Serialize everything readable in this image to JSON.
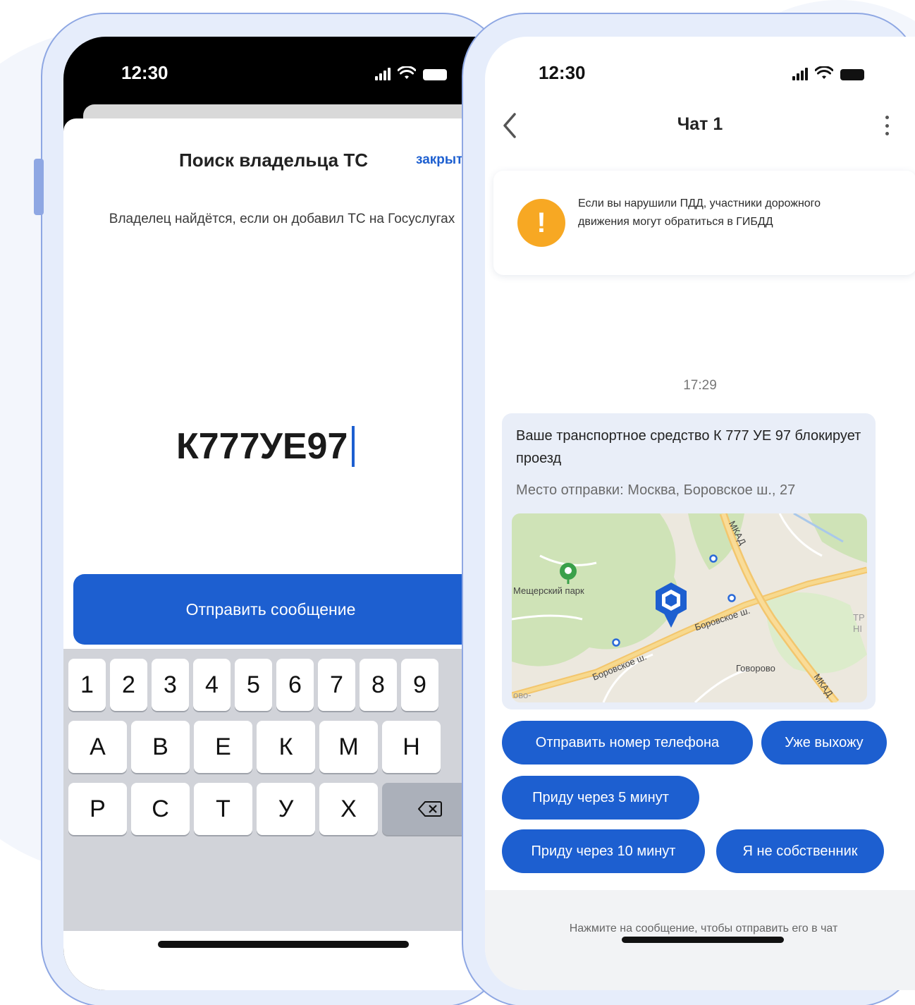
{
  "left_phone": {
    "status_time": "12:30",
    "sheet_title": "Поиск владельца ТС",
    "close_label": "закрыть",
    "hint": "Владелец найдётся, если он добавил ТС на Госуслугах",
    "plate_value": "К777УЕ97",
    "send_button": "Отправить сообщение",
    "keyboard": {
      "row1": [
        "1",
        "2",
        "3",
        "4",
        "5",
        "6",
        "7",
        "8",
        "9"
      ],
      "row2": [
        "А",
        "В",
        "Е",
        "К",
        "М",
        "Н"
      ],
      "row3": [
        "Р",
        "С",
        "Т",
        "У",
        "Х"
      ]
    }
  },
  "right_phone": {
    "status_time": "12:30",
    "chat_title": "Чат 1",
    "notice": {
      "text": "Если вы нарушили ПДД, участники дорожного движения могут обратиться в ГИБДД",
      "icon_glyph": "!"
    },
    "message_time": "17:29",
    "message": {
      "text": "Ваше транспортное средство К 777 УЕ 97 блокирует проезд",
      "place": "Место отправки: Москва, Боровское ш., 27"
    },
    "map_labels": {
      "park": "Мещерский парк",
      "road1": "Боровское ш.",
      "road2": "Боровское ш.",
      "district": "Говорово",
      "ring1": "МКАД",
      "ring2": "МКАД",
      "partial1": "ТР",
      "partial2": "НІ",
      "partial3": "ово-"
    },
    "quick_replies": [
      "Отправить номер телефона",
      "Уже выхожу",
      "Приду через 5 минут",
      "Приду через 10 минут",
      "Я не собственник"
    ],
    "footer_hint": "Нажмите на сообщение, чтобы отправить его в чат"
  },
  "colors": {
    "accent": "#1d5fd0",
    "frame": "#8ea7e3",
    "warning": "#f7a823"
  }
}
